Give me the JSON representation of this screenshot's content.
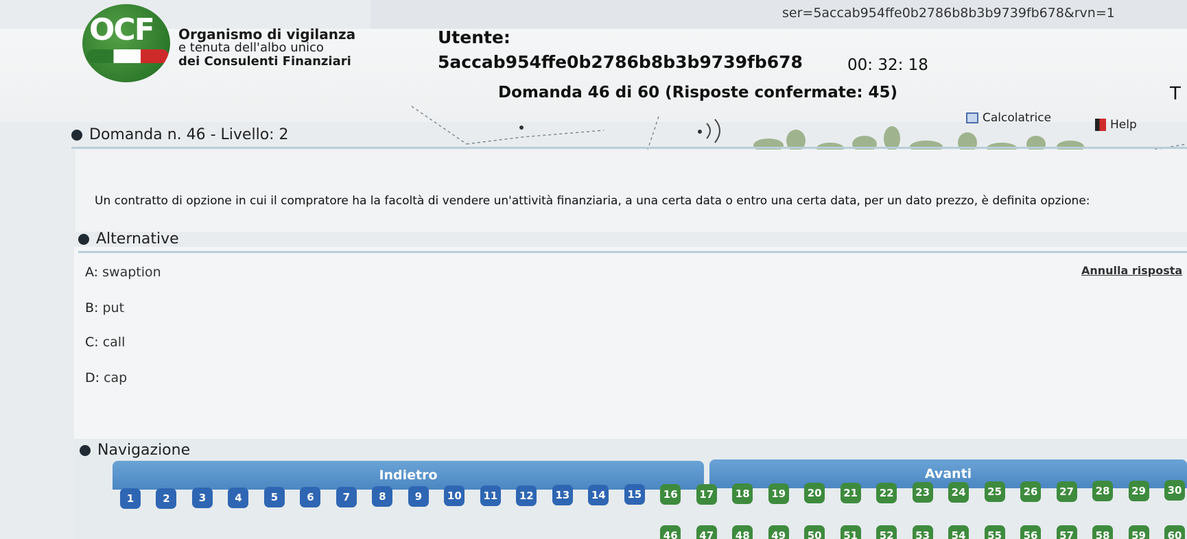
{
  "url_text": "ser=5accab954ffe0b2786b8b3b9739fb678&rvn=1",
  "header": {
    "logo_text": "OCF",
    "org_line1": "Organismo di vigilanza",
    "org_line2": "e tenuta dell'albo unico",
    "org_line3": "dei Consulenti Finanziari",
    "user_label": "Utente:",
    "user_id": "5accab954ffe0b2786b8b3b9739fb678",
    "timer": "00: 32: 18",
    "question_counter": "Domanda 46 di 60 (Risposte confermate: 45)",
    "calculator_label": "Calcolatrice",
    "help_label": "Help",
    "edge_char": "T"
  },
  "question": {
    "section_title": "Domanda n. 46 - Livello: 2",
    "text": "Un contratto di opzione in cui il compratore ha la facoltà di vendere un'attività finanziaria, a una certa data o entro una certa data, per un dato prezzo, è definita opzione:"
  },
  "alternatives": {
    "section_title": "Alternative",
    "clear_label": "Annulla risposta",
    "items": [
      {
        "letter": "A:",
        "text": "swaption"
      },
      {
        "letter": "B:",
        "text": "put"
      },
      {
        "letter": "C:",
        "text": "call"
      },
      {
        "letter": "D:",
        "text": "cap"
      }
    ]
  },
  "navigation": {
    "section_title": "Navigazione",
    "back_label": "Indietro",
    "next_label": "Avanti",
    "row1": [
      "1",
      "2",
      "3",
      "4",
      "5",
      "6",
      "7",
      "8",
      "9",
      "10",
      "11",
      "12",
      "13",
      "14",
      "15",
      "16",
      "17",
      "18",
      "19",
      "20",
      "21",
      "22",
      "23",
      "24",
      "25",
      "26",
      "27",
      "28",
      "29",
      "30"
    ],
    "row2": [
      "46",
      "47",
      "48",
      "49",
      "50",
      "51",
      "52",
      "53",
      "54",
      "55",
      "56",
      "57",
      "58",
      "59",
      "60"
    ],
    "colors": {
      "answered": "#2f66b3",
      "late": "#3e8b3e"
    }
  }
}
